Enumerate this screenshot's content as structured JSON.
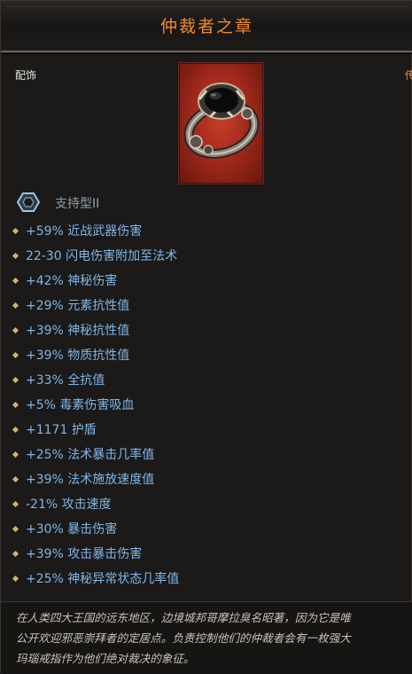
{
  "item": {
    "name": "仲裁者之章",
    "type": "配饰",
    "rarity": "传",
    "support": "支持型II",
    "affixes": [
      "+59% 近战武器伤害",
      "22-30 闪电伤害附加至法术",
      "+42% 神秘伤害",
      "+29% 元素抗性值",
      "+39% 神秘抗性值",
      "+39% 物质抗性值",
      "+33% 全抗值",
      "+5% 毒素伤害吸血",
      "+1171 护盾",
      "+25% 法术暴击几率值",
      "+39% 法术施放速度值",
      "-21% 攻击速度",
      "+30% 暴击伤害",
      "+39% 攻击暴击伤害",
      "+25% 神秘异常状态几率值"
    ],
    "lore": [
      "在人类四大王国的远东地区，边境城邦哥摩拉臭名昭著，因为它是唯",
      "公开欢迎邪恶崇拜者的定居点。负责控制他们的仲裁者会有一枚强大",
      "玛瑙戒指作为他们绝对裁决的象征。"
    ]
  },
  "colors": {
    "title": "#f28b29",
    "affix": "#7fb6e8",
    "support": "#8ea0ae",
    "item_background": "#b0301f"
  },
  "icons": {
    "item_image": "onyx-ring-icon",
    "support": "hexagon-icon",
    "affix_bullet": "diamond-bullet-icon"
  }
}
